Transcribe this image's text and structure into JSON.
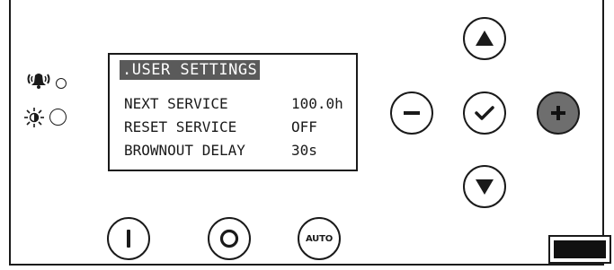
{
  "display": {
    "menu_title": ".USER SETTINGS",
    "rows": [
      {
        "label": "NEXT SERVICE",
        "value": "100.0h"
      },
      {
        "label": "RESET SERVICE",
        "value": "OFF"
      },
      {
        "label": "BROWNOUT DELAY",
        "value": "30s"
      }
    ]
  },
  "indicators": {
    "alarm_icon": "alarm-bell-icon",
    "mains_icon": "sun-icon"
  },
  "buttons": {
    "up": "triangle-up-icon",
    "down": "triangle-down-icon",
    "minus": "minus-icon",
    "confirm": "checkmark-icon",
    "plus": "plus-icon",
    "start": "I",
    "stop": "O",
    "auto": "AUTO"
  },
  "colors": {
    "outline": "#1a1a1a",
    "title_bar": "#5a5a5a",
    "plus_button": "#6e6e6e",
    "slot_fill": "#111111"
  }
}
